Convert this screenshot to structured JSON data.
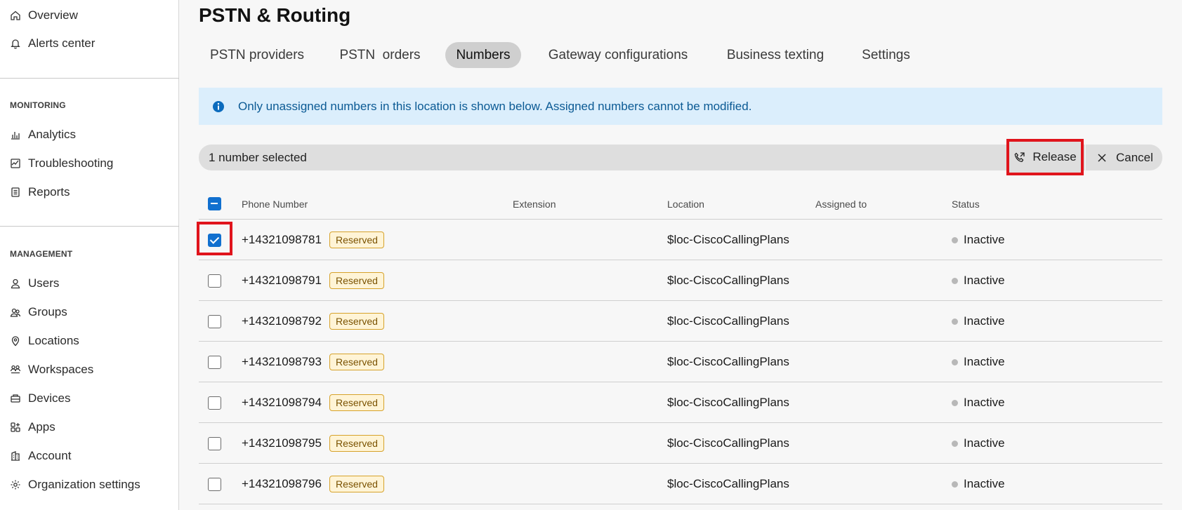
{
  "sidebar": {
    "top_items": [
      {
        "label": "Overview",
        "icon": "home-icon"
      },
      {
        "label": "Alerts center",
        "icon": "bell-icon"
      }
    ],
    "monitoring": {
      "title": "MONITORING",
      "items": [
        {
          "label": "Analytics",
          "icon": "bar-chart-icon"
        },
        {
          "label": "Troubleshooting",
          "icon": "pulse-icon"
        },
        {
          "label": "Reports",
          "icon": "document-icon"
        }
      ]
    },
    "management": {
      "title": "MANAGEMENT",
      "items": [
        {
          "label": "Users",
          "icon": "user-icon"
        },
        {
          "label": "Groups",
          "icon": "group-icon"
        },
        {
          "label": "Locations",
          "icon": "location-pin-icon"
        },
        {
          "label": "Workspaces",
          "icon": "workspace-icon"
        },
        {
          "label": "Devices",
          "icon": "device-icon"
        },
        {
          "label": "Apps",
          "icon": "apps-icon"
        },
        {
          "label": "Account",
          "icon": "account-icon"
        },
        {
          "label": "Organization settings",
          "icon": "gear-icon"
        }
      ]
    }
  },
  "page": {
    "title": "PSTN & Routing",
    "tabs": [
      {
        "label": "PSTN providers",
        "active": false
      },
      {
        "label": "PSTN  orders",
        "active": false
      },
      {
        "label": "Numbers",
        "active": true
      },
      {
        "label": "Gateway configurations",
        "active": false
      },
      {
        "label": "Business texting",
        "active": false
      },
      {
        "label": "Settings",
        "active": false
      }
    ],
    "info_banner": "Only unassigned numbers in this location is shown below. Assigned numbers cannot be modified.",
    "selection_bar": {
      "text": "1 number selected",
      "release_label": "Release",
      "cancel_label": "Cancel"
    }
  },
  "table": {
    "columns": [
      "Phone Number",
      "Extension",
      "Location",
      "Assigned to",
      "Status"
    ],
    "rows": [
      {
        "phone": "+14321098781",
        "badge": "Reserved",
        "extension": "",
        "location": "$loc-CiscoCallingPlans",
        "assigned_to": "",
        "status": "Inactive",
        "checked": true
      },
      {
        "phone": "+14321098791",
        "badge": "Reserved",
        "extension": "",
        "location": "$loc-CiscoCallingPlans",
        "assigned_to": "",
        "status": "Inactive",
        "checked": false
      },
      {
        "phone": "+14321098792",
        "badge": "Reserved",
        "extension": "",
        "location": "$loc-CiscoCallingPlans",
        "assigned_to": "",
        "status": "Inactive",
        "checked": false
      },
      {
        "phone": "+14321098793",
        "badge": "Reserved",
        "extension": "",
        "location": "$loc-CiscoCallingPlans",
        "assigned_to": "",
        "status": "Inactive",
        "checked": false
      },
      {
        "phone": "+14321098794",
        "badge": "Reserved",
        "extension": "",
        "location": "$loc-CiscoCallingPlans",
        "assigned_to": "",
        "status": "Inactive",
        "checked": false
      },
      {
        "phone": "+14321098795",
        "badge": "Reserved",
        "extension": "",
        "location": "$loc-CiscoCallingPlans",
        "assigned_to": "",
        "status": "Inactive",
        "checked": false
      },
      {
        "phone": "+14321098796",
        "badge": "Reserved",
        "extension": "",
        "location": "$loc-CiscoCallingPlans",
        "assigned_to": "",
        "status": "Inactive",
        "checked": false
      }
    ]
  },
  "colors": {
    "accent": "#1170cf",
    "highlight_box": "#e0141c",
    "banner_bg": "#dbeefc",
    "banner_text": "#0b5a94",
    "badge_border": "#d6a22a",
    "badge_bg": "#fff4d6"
  }
}
